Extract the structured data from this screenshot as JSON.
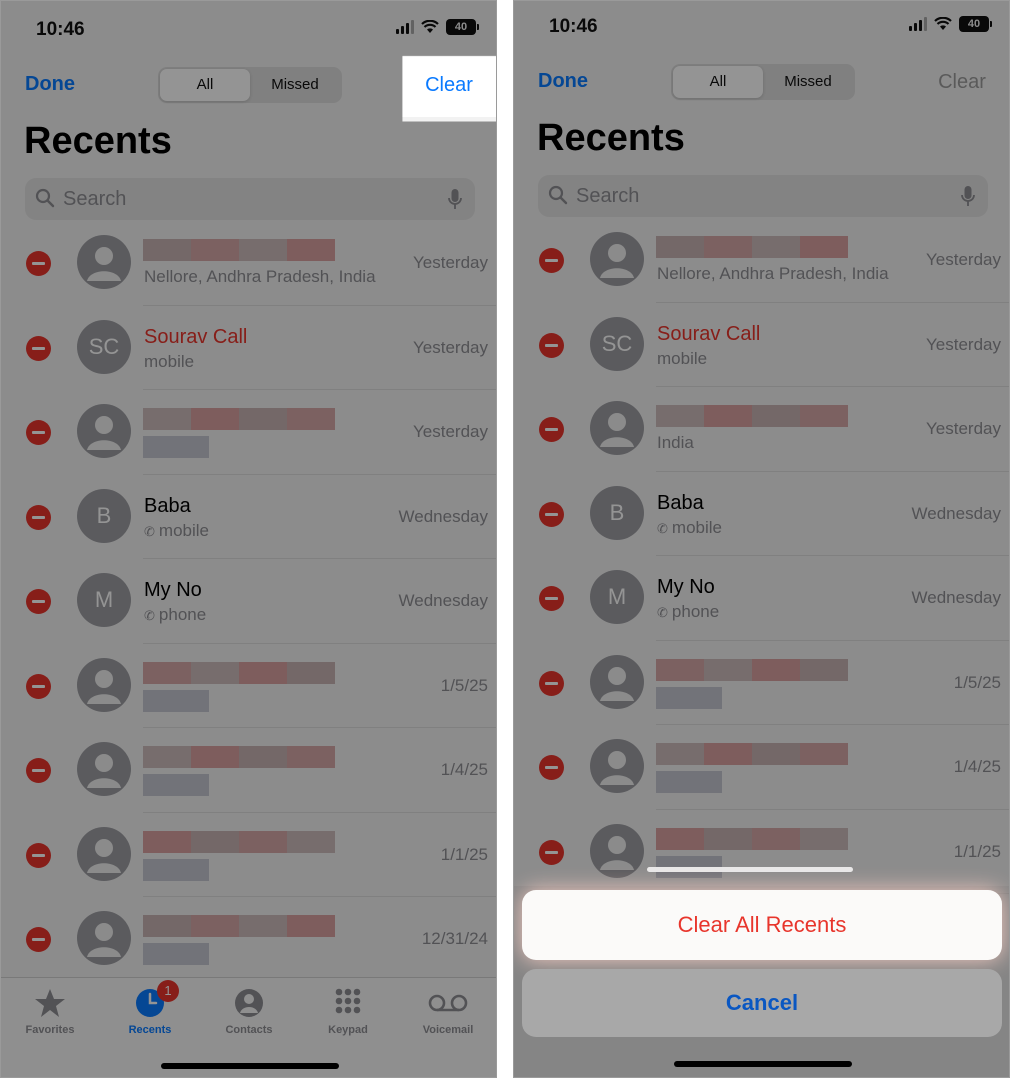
{
  "colors": {
    "accent": "#0a7aff",
    "destructive": "#e8352c",
    "badge": "#e8352c"
  },
  "status": {
    "time": "10:46",
    "battery": "40"
  },
  "nav": {
    "done": "Done",
    "clear": "Clear",
    "segments": [
      "All",
      "Missed"
    ],
    "active_segment": "All"
  },
  "title": "Recents",
  "search": {
    "placeholder": "Search"
  },
  "calls_left": [
    {
      "name": "",
      "subtitle": "Nellore, Andhra Pradesh, India",
      "date": "Yesterday",
      "missed": false,
      "avatar": ""
    },
    {
      "name": "Sourav Call",
      "subtitle": "mobile",
      "date": "Yesterday",
      "missed": true,
      "avatar": "SC"
    },
    {
      "name": "",
      "subtitle": "",
      "date": "Yesterday",
      "missed": false,
      "avatar": ""
    },
    {
      "name": "Baba",
      "subtitle": "mobile",
      "date": "Wednesday",
      "missed": false,
      "avatar": "B",
      "phone_icon": true
    },
    {
      "name": "My No",
      "subtitle": "phone",
      "date": "Wednesday",
      "missed": false,
      "avatar": "M",
      "phone_icon": true
    },
    {
      "name": "",
      "subtitle": "",
      "date": "1/5/25",
      "missed": false,
      "avatar": ""
    },
    {
      "name": "",
      "subtitle": "",
      "date": "1/4/25",
      "missed": false,
      "avatar": ""
    },
    {
      "name": "",
      "subtitle": "",
      "date": "1/1/25",
      "missed": false,
      "avatar": ""
    },
    {
      "name": "",
      "subtitle": "",
      "date": "12/31/24",
      "missed": false,
      "avatar": ""
    }
  ],
  "calls_right": [
    {
      "name": "",
      "subtitle": "Nellore, Andhra Pradesh, India",
      "date": "Yesterday",
      "missed": false,
      "avatar": ""
    },
    {
      "name": "Sourav Call",
      "subtitle": "mobile",
      "date": "Yesterday",
      "missed": true,
      "avatar": "SC"
    },
    {
      "name": "",
      "subtitle": "India",
      "date": "Yesterday",
      "missed": false,
      "avatar": ""
    },
    {
      "name": "Baba",
      "subtitle": "mobile",
      "date": "Wednesday",
      "missed": false,
      "avatar": "B",
      "phone_icon": true
    },
    {
      "name": "My No",
      "subtitle": "phone",
      "date": "Wednesday",
      "missed": false,
      "avatar": "M",
      "phone_icon": true
    },
    {
      "name": "",
      "subtitle": "",
      "date": "1/5/25",
      "missed": false,
      "avatar": ""
    },
    {
      "name": "",
      "subtitle": "",
      "date": "1/4/25",
      "missed": false,
      "avatar": ""
    },
    {
      "name": "",
      "subtitle": "",
      "date": "1/1/25",
      "missed": false,
      "avatar": ""
    }
  ],
  "tabs": [
    {
      "label": "Favorites",
      "icon": "star-icon"
    },
    {
      "label": "Recents",
      "icon": "clock-icon",
      "active": true,
      "badge": "1"
    },
    {
      "label": "Contacts",
      "icon": "person-circle-icon"
    },
    {
      "label": "Keypad",
      "icon": "keypad-icon"
    },
    {
      "label": "Voicemail",
      "icon": "voicemail-icon"
    }
  ],
  "action_sheet": {
    "clear_all": "Clear All Recents",
    "cancel": "Cancel"
  }
}
